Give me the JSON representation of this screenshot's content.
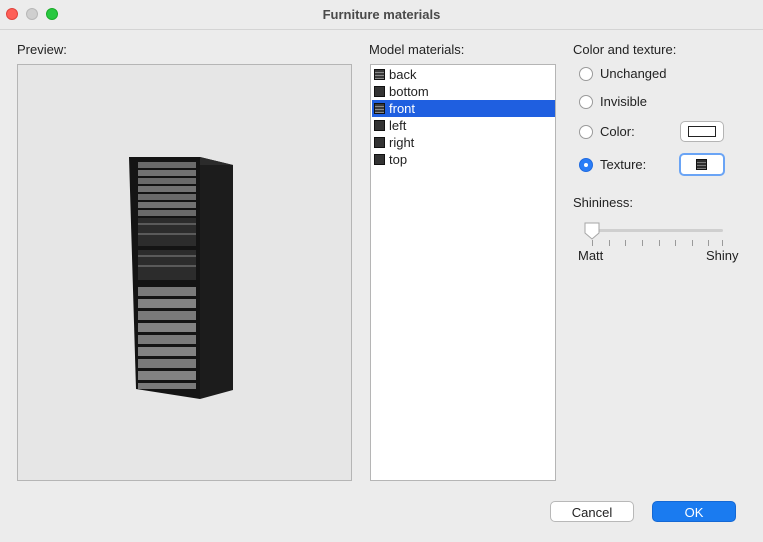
{
  "window": {
    "title": "Furniture materials"
  },
  "preview": {
    "label": "Preview:"
  },
  "materials": {
    "label": "Model materials:",
    "items": [
      {
        "label": "back",
        "swatch": "texture"
      },
      {
        "label": "bottom",
        "swatch": "solid"
      },
      {
        "label": "front",
        "swatch": "texture",
        "selected": true
      },
      {
        "label": "left",
        "swatch": "solid"
      },
      {
        "label": "right",
        "swatch": "solid"
      },
      {
        "label": "top",
        "swatch": "solid"
      }
    ]
  },
  "color_texture": {
    "label": "Color and texture:",
    "options": {
      "unchanged": "Unchanged",
      "invisible": "Invisible",
      "color": "Color:",
      "texture": "Texture:"
    },
    "selected": "texture"
  },
  "shininess": {
    "label": "Shininess:",
    "min_label": "Matt",
    "max_label": "Shiny",
    "value": 0
  },
  "buttons": {
    "cancel": "Cancel",
    "ok": "OK"
  },
  "colors": {
    "accent": "#1a7bf0",
    "selection": "#1f5fe0"
  }
}
